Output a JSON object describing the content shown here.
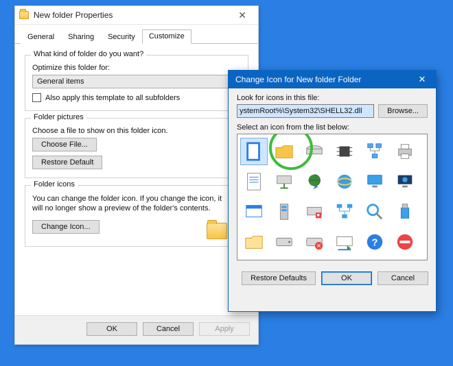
{
  "props": {
    "title": "New folder Properties",
    "close_glyph": "✕",
    "tabs": [
      "General",
      "Sharing",
      "Security",
      "Customize"
    ],
    "active_tab": 3,
    "group1": {
      "legend": "What kind of folder do you want?",
      "optimize_label": "Optimize this folder for:",
      "select_value": "General items",
      "check_label": "Also apply this template to all subfolders"
    },
    "group2": {
      "legend": "Folder pictures",
      "desc": "Choose a file to show on this folder icon.",
      "choose_btn": "Choose File...",
      "restore_btn": "Restore Default"
    },
    "group3": {
      "legend": "Folder icons",
      "desc": "You can change the folder icon. If you change the icon, it will no longer show a preview of the folder's contents.",
      "change_btn": "Change Icon..."
    },
    "ok_btn": "OK",
    "cancel_btn": "Cancel",
    "apply_btn": "Apply"
  },
  "dlg": {
    "title": "Change Icon for New folder Folder",
    "close_glyph": "✕",
    "look_label": "Look for icons in this file:",
    "path_value": "ystemRoot%\\System32\\SHELL32.dll",
    "browse_btn": "Browse...",
    "select_label": "Select an icon from the list below:",
    "restore_btn": "Restore Defaults",
    "ok_btn": "OK",
    "cancel_btn": "Cancel"
  }
}
